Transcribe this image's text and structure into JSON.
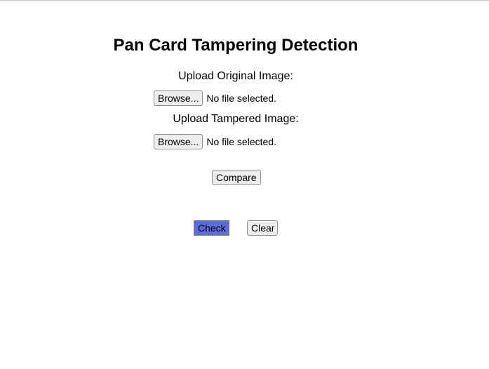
{
  "page": {
    "title": "Pan Card Tampering Detection"
  },
  "form": {
    "original": {
      "label": "Upload Original Image:",
      "browse_label": "Browse...",
      "status": "No file selected."
    },
    "tampered": {
      "label": "Upload Tampered Image:",
      "browse_label": "Browse...",
      "status": "No file selected."
    },
    "compare_label": "Compare"
  },
  "actions": {
    "check_label": "Check",
    "clear_label": "Clear"
  },
  "colors": {
    "check_button_bg": "#5b6cdc",
    "button_bg": "#ededed"
  }
}
